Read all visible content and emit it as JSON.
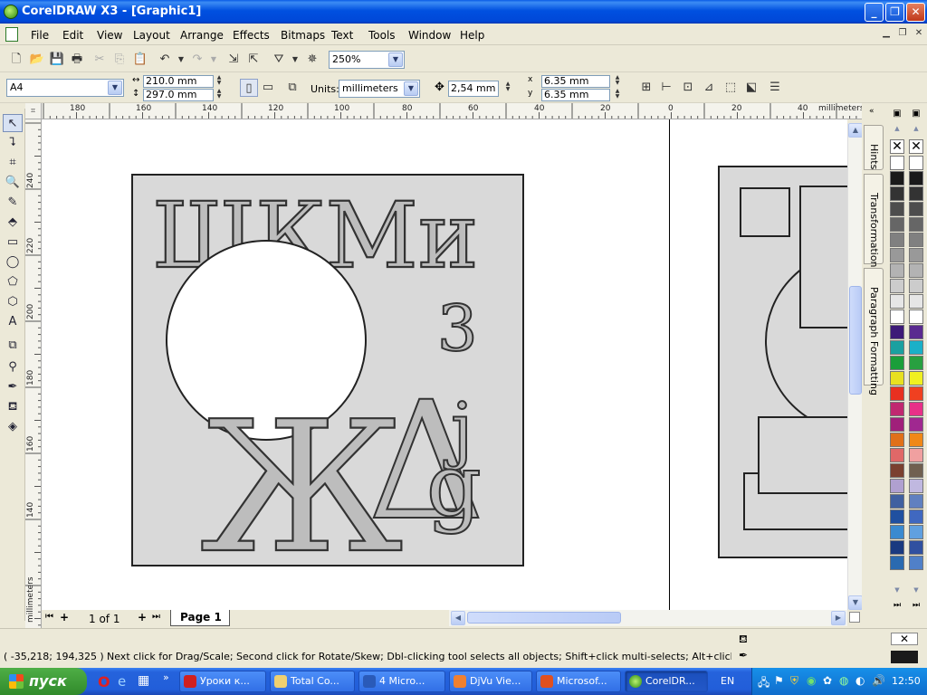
{
  "window": {
    "title": "CorelDRAW X3 - [Graphic1]",
    "buttons": {
      "minimize": "_",
      "maximize": "❐",
      "close": "✕"
    }
  },
  "menu": {
    "items": [
      "File",
      "Edit",
      "View",
      "Layout",
      "Arrange",
      "Effects",
      "Bitmaps",
      "Text",
      "Tools",
      "Window",
      "Help"
    ]
  },
  "standard_toolbar": {
    "zoom": "250%"
  },
  "property_bar": {
    "page_size": "A4",
    "width": "210.0 mm",
    "height": "297.0 mm",
    "units_label": "Units:",
    "units": "millimeters",
    "nudge": "2,54 mm",
    "dup_x": "6.35 mm",
    "dup_y": "6.35 mm",
    "x_label": "x",
    "y_label": "y"
  },
  "rulers": {
    "h_labels": [
      "180",
      "160",
      "140",
      "120",
      "100",
      "80",
      "60",
      "40",
      "20",
      "0",
      "20",
      "40"
    ],
    "h_unit": "millimeters",
    "v_labels": [
      "240",
      "220",
      "200",
      "180",
      "160",
      "140"
    ],
    "v_unit": "millimeters"
  },
  "artwork": {
    "letters_top": "ШКМи",
    "letter_3": "3",
    "letter_j": "j",
    "letter_delta": "Δ",
    "letter_g": "g",
    "letter_zh": "Ж"
  },
  "dockers": {
    "tabs": [
      "Hints",
      "Transformation",
      "Paragraph Formatting"
    ]
  },
  "page_nav": {
    "counter": "1 of 1",
    "page_tab": "Page 1"
  },
  "palette": {
    "col1": [
      "#ffffff",
      "#1a1a1a",
      "#333333",
      "#4d4d4d",
      "#666666",
      "#808080",
      "#999999",
      "#b3b3b3",
      "#cccccc",
      "#e6e6e6",
      "#ffffff",
      "#3d1a78",
      "#1aa0a0",
      "#1a9e3a",
      "#e8e020",
      "#e83020",
      "#c02870",
      "#a0207a",
      "#e0701a",
      "#e06868",
      "#7a4030",
      "#b0a0d0",
      "#4060a0",
      "#2050a0",
      "#3a8ad0",
      "#1a3a80",
      "#2a6ab0",
      "#182870"
    ],
    "col2": [
      "#ffffff",
      "#1a1a1a",
      "#333333",
      "#4d4d4d",
      "#666666",
      "#808080",
      "#999999",
      "#b3b3b3",
      "#cccccc",
      "#e6e6e6",
      "#ffffff",
      "#5a2a90",
      "#1ab0c8",
      "#28a040",
      "#f0f020",
      "#f04020",
      "#e83088",
      "#a02890",
      "#f08818",
      "#f0a0a0",
      "#706050",
      "#c0b8e0",
      "#6080c0",
      "#4068c0",
      "#60a0e0",
      "#3050a0",
      "#5080c8",
      "#304090"
    ]
  },
  "status": {
    "coords": "( -35,218; 194,325 )",
    "message": "Next click for Drag/Scale; Second click for Rotate/Skew; Dbl-clicking tool selects all objects; Shift+click multi-selects; Alt+click digs"
  },
  "taskbar": {
    "start": "пуск",
    "tasks": [
      "Уроки к...",
      "Total Co...",
      "4 Micro...",
      "DjVu Vie...",
      "Microsof...",
      "CorelDR..."
    ],
    "lang": "EN",
    "clock": "12:50"
  }
}
